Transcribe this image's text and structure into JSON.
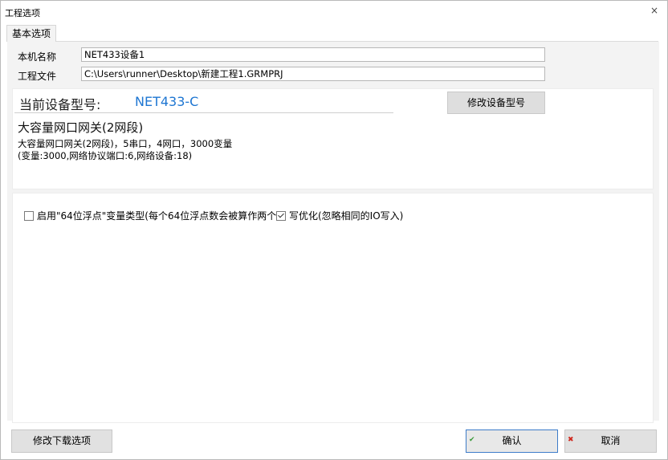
{
  "window": {
    "title": "工程选项",
    "close_glyph": "×"
  },
  "tabs": [
    {
      "label": "基本选项"
    }
  ],
  "form": {
    "machine_name_label": "本机名称",
    "machine_name_value": "NET433设备1",
    "project_file_label": "工程文件",
    "project_file_value": "C:\\Users\\runner\\Desktop\\新建工程1.GRMPRJ"
  },
  "device": {
    "caption": "当前设备型号:",
    "model": "NET433-C",
    "modify_button": "修改设备型号",
    "name": "大容量网口网关(2网段)",
    "desc_line1": "大容量网口网关(2网段)，5串口，4网口，3000变量",
    "desc_line2": "(变量:3000,网络协议端口:6,网络设备:18)",
    "model_color": "#1e76d2"
  },
  "options": {
    "float64": {
      "label": "启用\"64位浮点\"变量类型(每个64位浮点数会被算作两个",
      "checked": false
    },
    "write_opt": {
      "label": "写优化(忽略相同的IO写入)",
      "checked": true
    }
  },
  "footer": {
    "download_options": "修改下载选项",
    "ok": "确认",
    "cancel": "取消",
    "ok_icon": "✔",
    "cancel_icon": "✖"
  }
}
